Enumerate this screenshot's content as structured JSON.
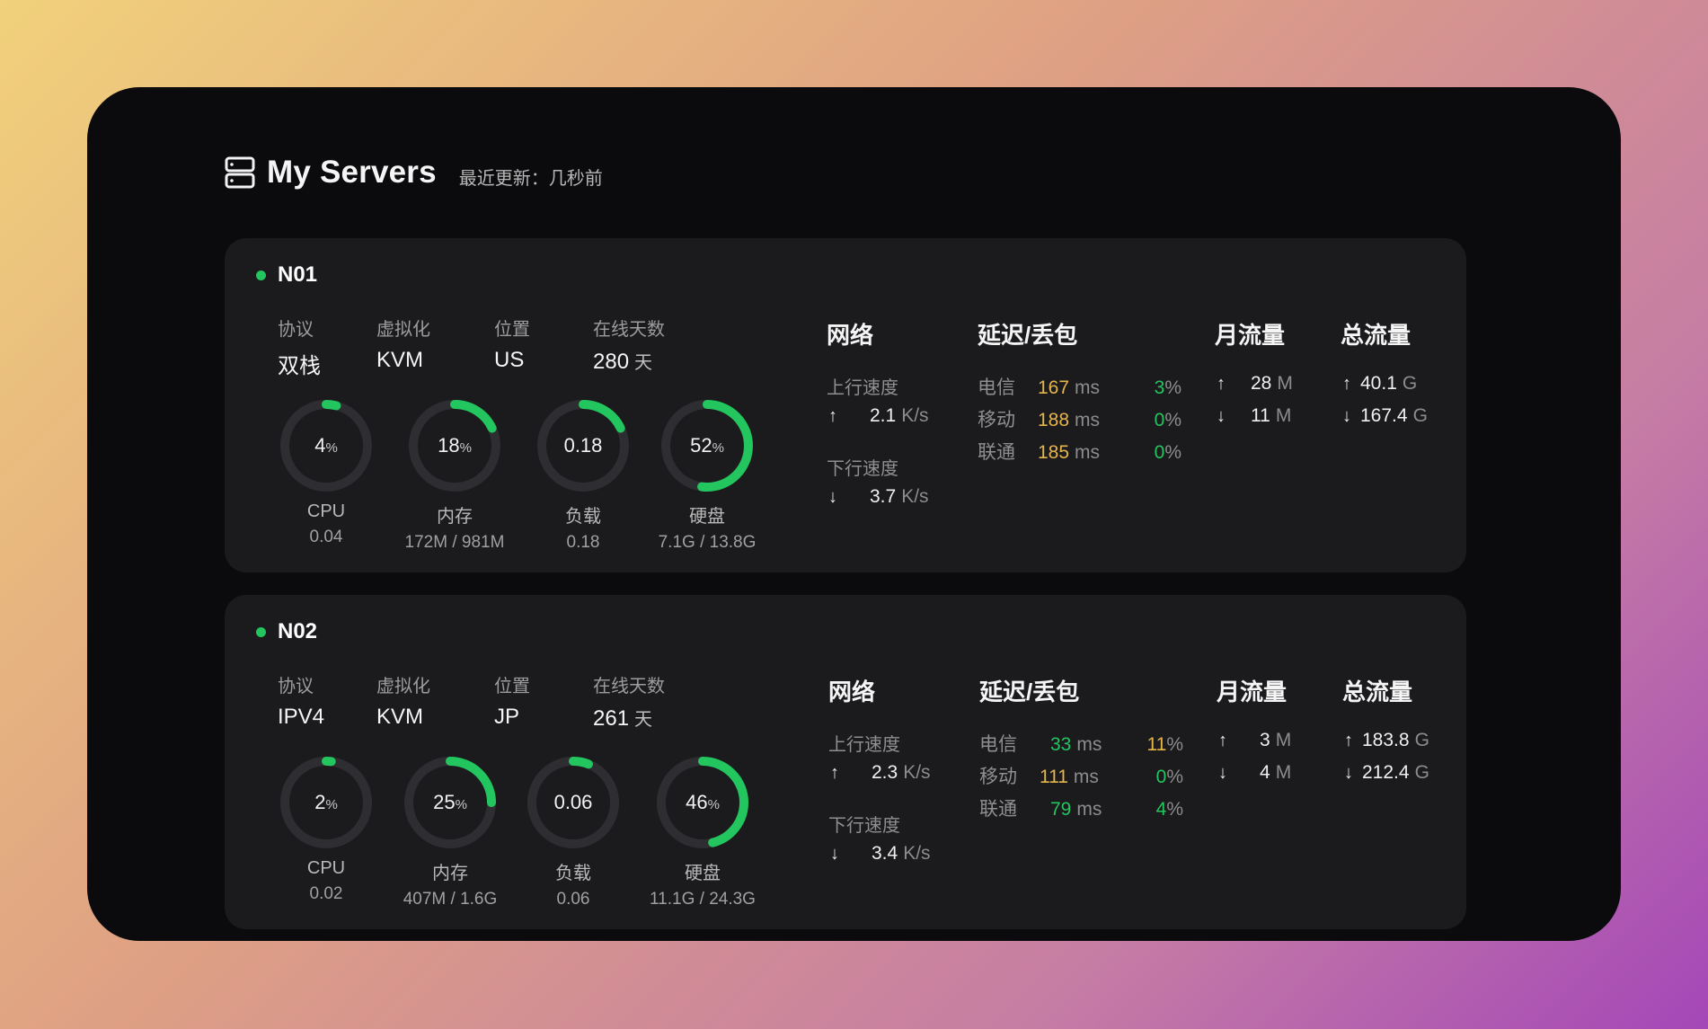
{
  "header": {
    "title": "My Servers",
    "updated": "最近更新：几秒前"
  },
  "colors": {
    "accent_green": "#22c55e",
    "latency_yellow": "#e6b54a",
    "card_bg": "#1b1b1e",
    "window_bg": "#0b0b0d",
    "gauge_track": "#2e2e32"
  },
  "servers": [
    {
      "name": "N01",
      "status": "online",
      "info_labels": {
        "protocol": "协议",
        "virt": "虚拟化",
        "location": "位置",
        "uptime": "在线天数"
      },
      "protocol": "双栈",
      "virt": "KVM",
      "location": "US",
      "uptime_days": "280",
      "uptime_unit": "天",
      "cpu": {
        "value": "4",
        "unit": "%",
        "fraction": 0.04,
        "label": "CPU",
        "sub": "0.04"
      },
      "mem": {
        "value": "18",
        "unit": "%",
        "fraction": 0.18,
        "label": "内存",
        "sub": "172M / 981M"
      },
      "load": {
        "value": "0.18",
        "unit": "",
        "fraction": 0.18,
        "label": "负载",
        "sub": "0.18"
      },
      "disk": {
        "value": "52",
        "unit": "%",
        "fraction": 0.52,
        "label": "硬盘",
        "sub": "7.1G / 13.8G"
      },
      "network": {
        "title": "网络",
        "up_label": "上行速度",
        "up_value": "2.1",
        "up_unit": "K/s",
        "down_label": "下行速度",
        "down_value": "3.7",
        "down_unit": "K/s"
      },
      "latency": {
        "title": "延迟/丢包",
        "rows": [
          {
            "isp": "电信",
            "ms": "167",
            "ms_unit": "ms",
            "loss": "3",
            "loss_unit": "%",
            "ms_color": "yellow",
            "loss_color": "green"
          },
          {
            "isp": "移动",
            "ms": "188",
            "ms_unit": "ms",
            "loss": "0",
            "loss_unit": "%",
            "ms_color": "yellow",
            "loss_color": "green"
          },
          {
            "isp": "联通",
            "ms": "185",
            "ms_unit": "ms",
            "loss": "0",
            "loss_unit": "%",
            "ms_color": "yellow",
            "loss_color": "green"
          }
        ]
      },
      "monthly": {
        "title": "月流量",
        "up": "28",
        "up_unit": "M",
        "down": "11",
        "down_unit": "M"
      },
      "total": {
        "title": "总流量",
        "up": "40.1",
        "up_unit": "G",
        "down": "167.4",
        "down_unit": "G"
      }
    },
    {
      "name": "N02",
      "status": "online",
      "info_labels": {
        "protocol": "协议",
        "virt": "虚拟化",
        "location": "位置",
        "uptime": "在线天数"
      },
      "protocol": "IPV4",
      "virt": "KVM",
      "location": "JP",
      "uptime_days": "261",
      "uptime_unit": "天",
      "cpu": {
        "value": "2",
        "unit": "%",
        "fraction": 0.02,
        "label": "CPU",
        "sub": "0.02"
      },
      "mem": {
        "value": "25",
        "unit": "%",
        "fraction": 0.25,
        "label": "内存",
        "sub": "407M / 1.6G"
      },
      "load": {
        "value": "0.06",
        "unit": "",
        "fraction": 0.06,
        "label": "负载",
        "sub": "0.06"
      },
      "disk": {
        "value": "46",
        "unit": "%",
        "fraction": 0.46,
        "label": "硬盘",
        "sub": "11.1G / 24.3G"
      },
      "network": {
        "title": "网络",
        "up_label": "上行速度",
        "up_value": "2.3",
        "up_unit": "K/s",
        "down_label": "下行速度",
        "down_value": "3.4",
        "down_unit": "K/s"
      },
      "latency": {
        "title": "延迟/丢包",
        "rows": [
          {
            "isp": "电信",
            "ms": "33",
            "ms_unit": "ms",
            "loss": "11",
            "loss_unit": "%",
            "ms_color": "green",
            "loss_color": "yellow"
          },
          {
            "isp": "移动",
            "ms": "111",
            "ms_unit": "ms",
            "loss": "0",
            "loss_unit": "%",
            "ms_color": "yellow",
            "loss_color": "green"
          },
          {
            "isp": "联通",
            "ms": "79",
            "ms_unit": "ms",
            "loss": "4",
            "loss_unit": "%",
            "ms_color": "green",
            "loss_color": "green"
          }
        ]
      },
      "monthly": {
        "title": "月流量",
        "up": "3",
        "up_unit": "M",
        "down": "4",
        "down_unit": "M"
      },
      "total": {
        "title": "总流量",
        "up": "183.8",
        "up_unit": "G",
        "down": "212.4",
        "down_unit": "G"
      }
    }
  ]
}
